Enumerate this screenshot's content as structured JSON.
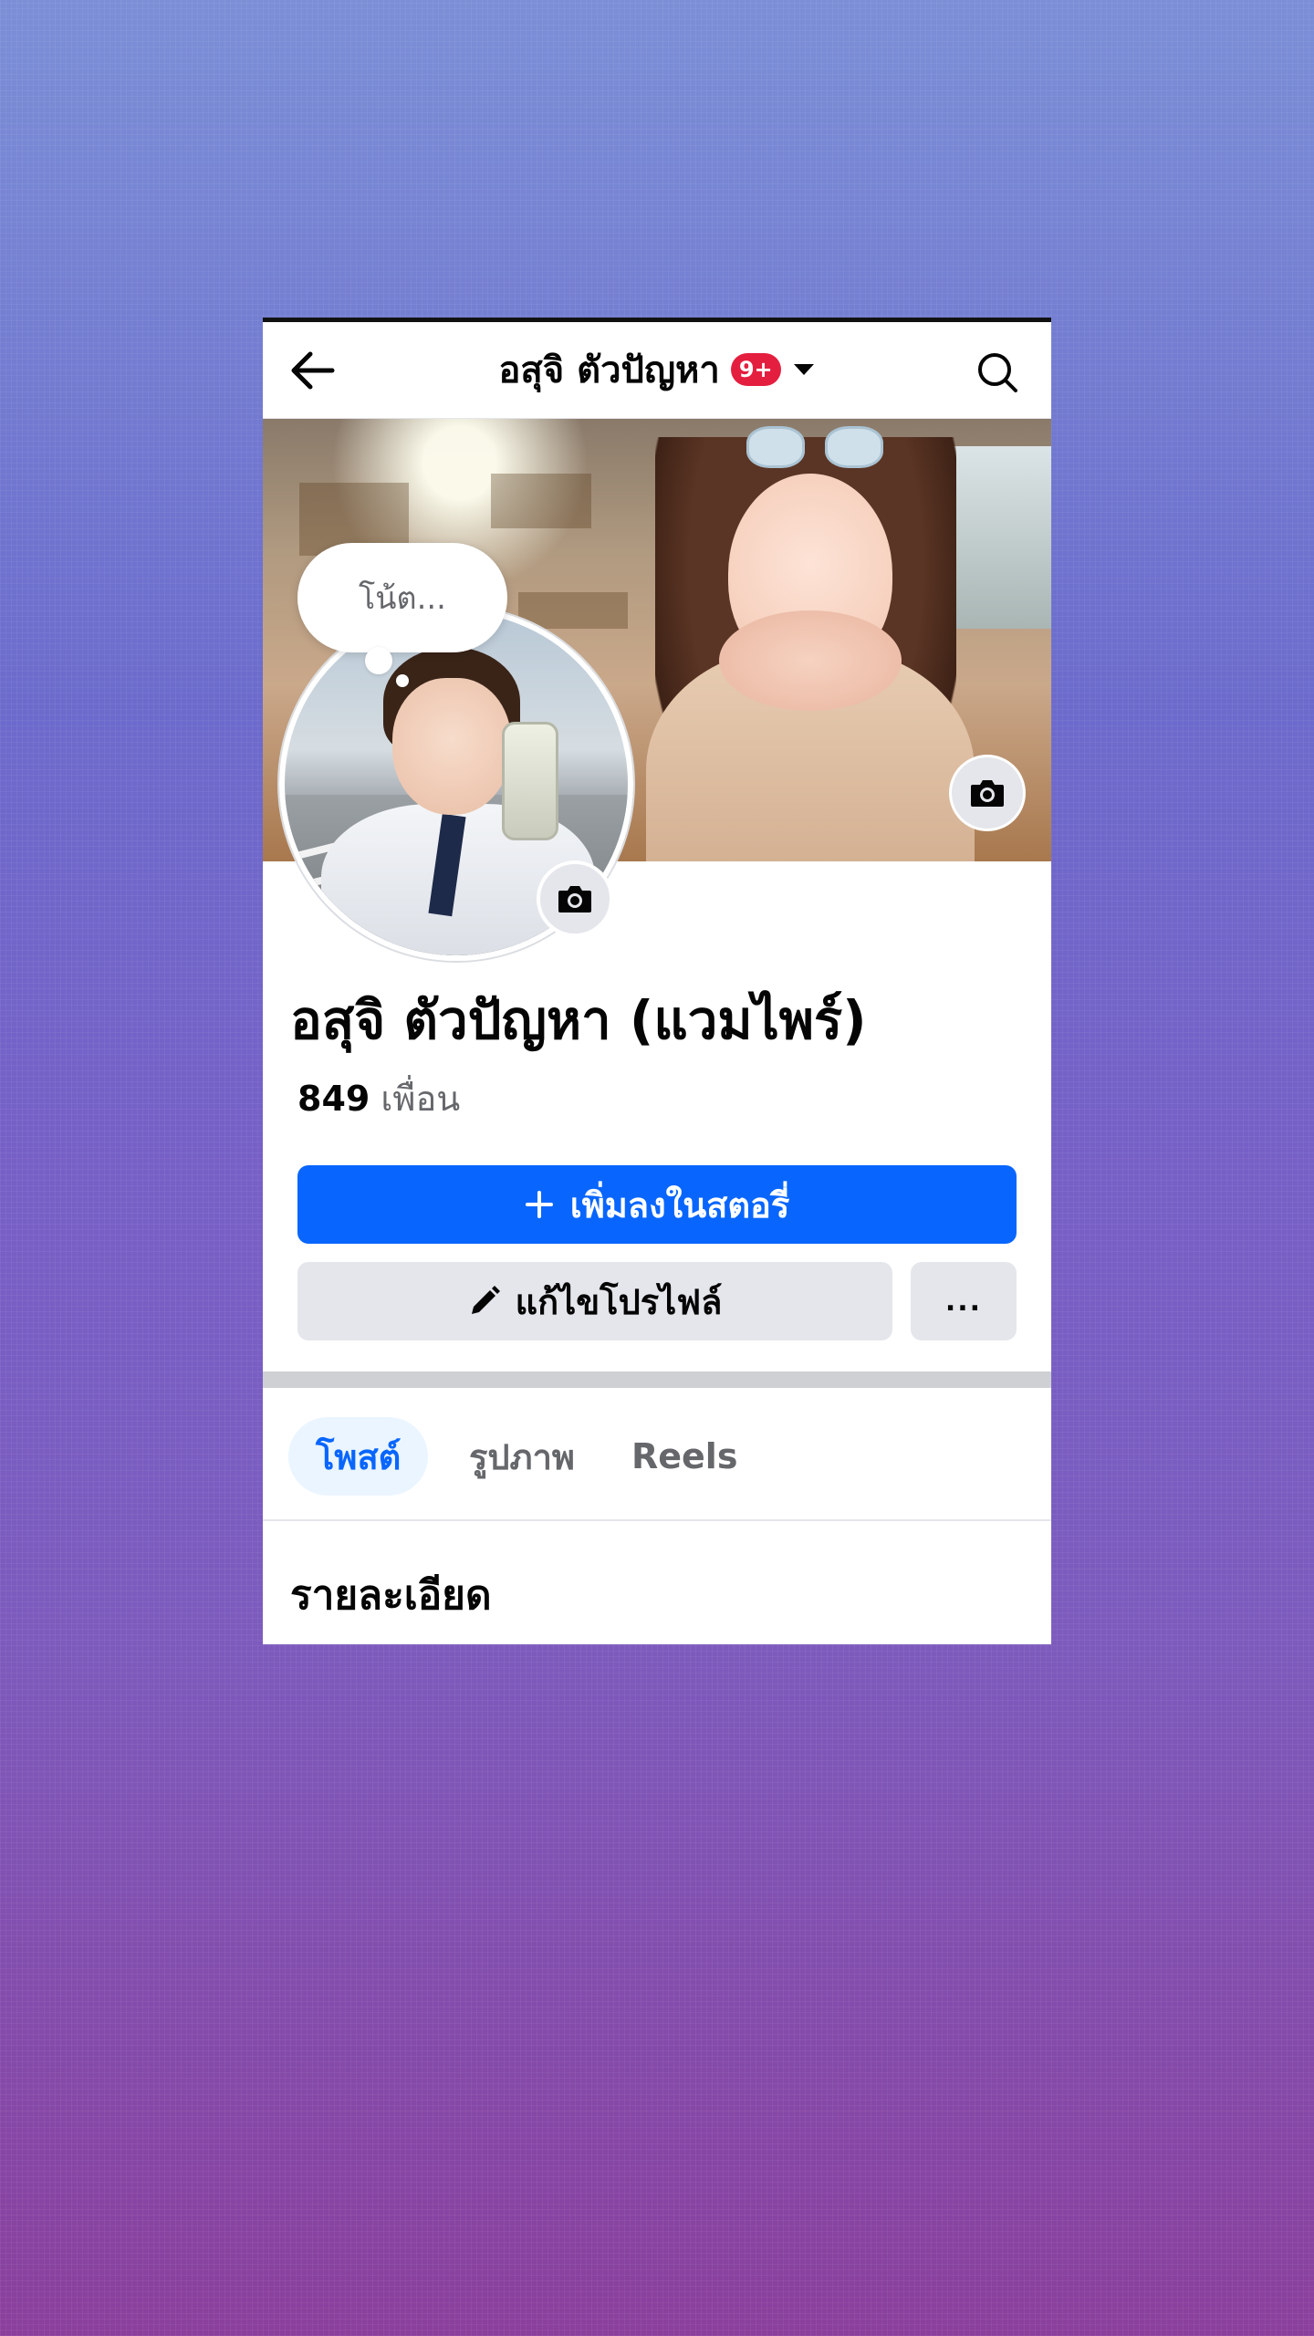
{
  "topbar": {
    "title": "อสุจิ ตัวปัญหา",
    "badge": "9+"
  },
  "note": {
    "placeholder": "โน้ต..."
  },
  "profile": {
    "name": "อสุจิ ตัวปัญหา (แวมไพร์)",
    "friends_count": "849",
    "friends_label": "เพื่อน"
  },
  "actions": {
    "add_story": "เพิ่มลงในสตอรี่",
    "edit_profile": "แก้ไขโปรไฟล์",
    "more": "..."
  },
  "tabs": [
    {
      "label": "โพสต์",
      "active": true
    },
    {
      "label": "รูปภาพ",
      "active": false
    },
    {
      "label": "Reels",
      "active": false
    }
  ],
  "details": {
    "title": "รายละเอียด"
  },
  "colors": {
    "accent": "#0866ff",
    "badge": "#e41e3f"
  }
}
